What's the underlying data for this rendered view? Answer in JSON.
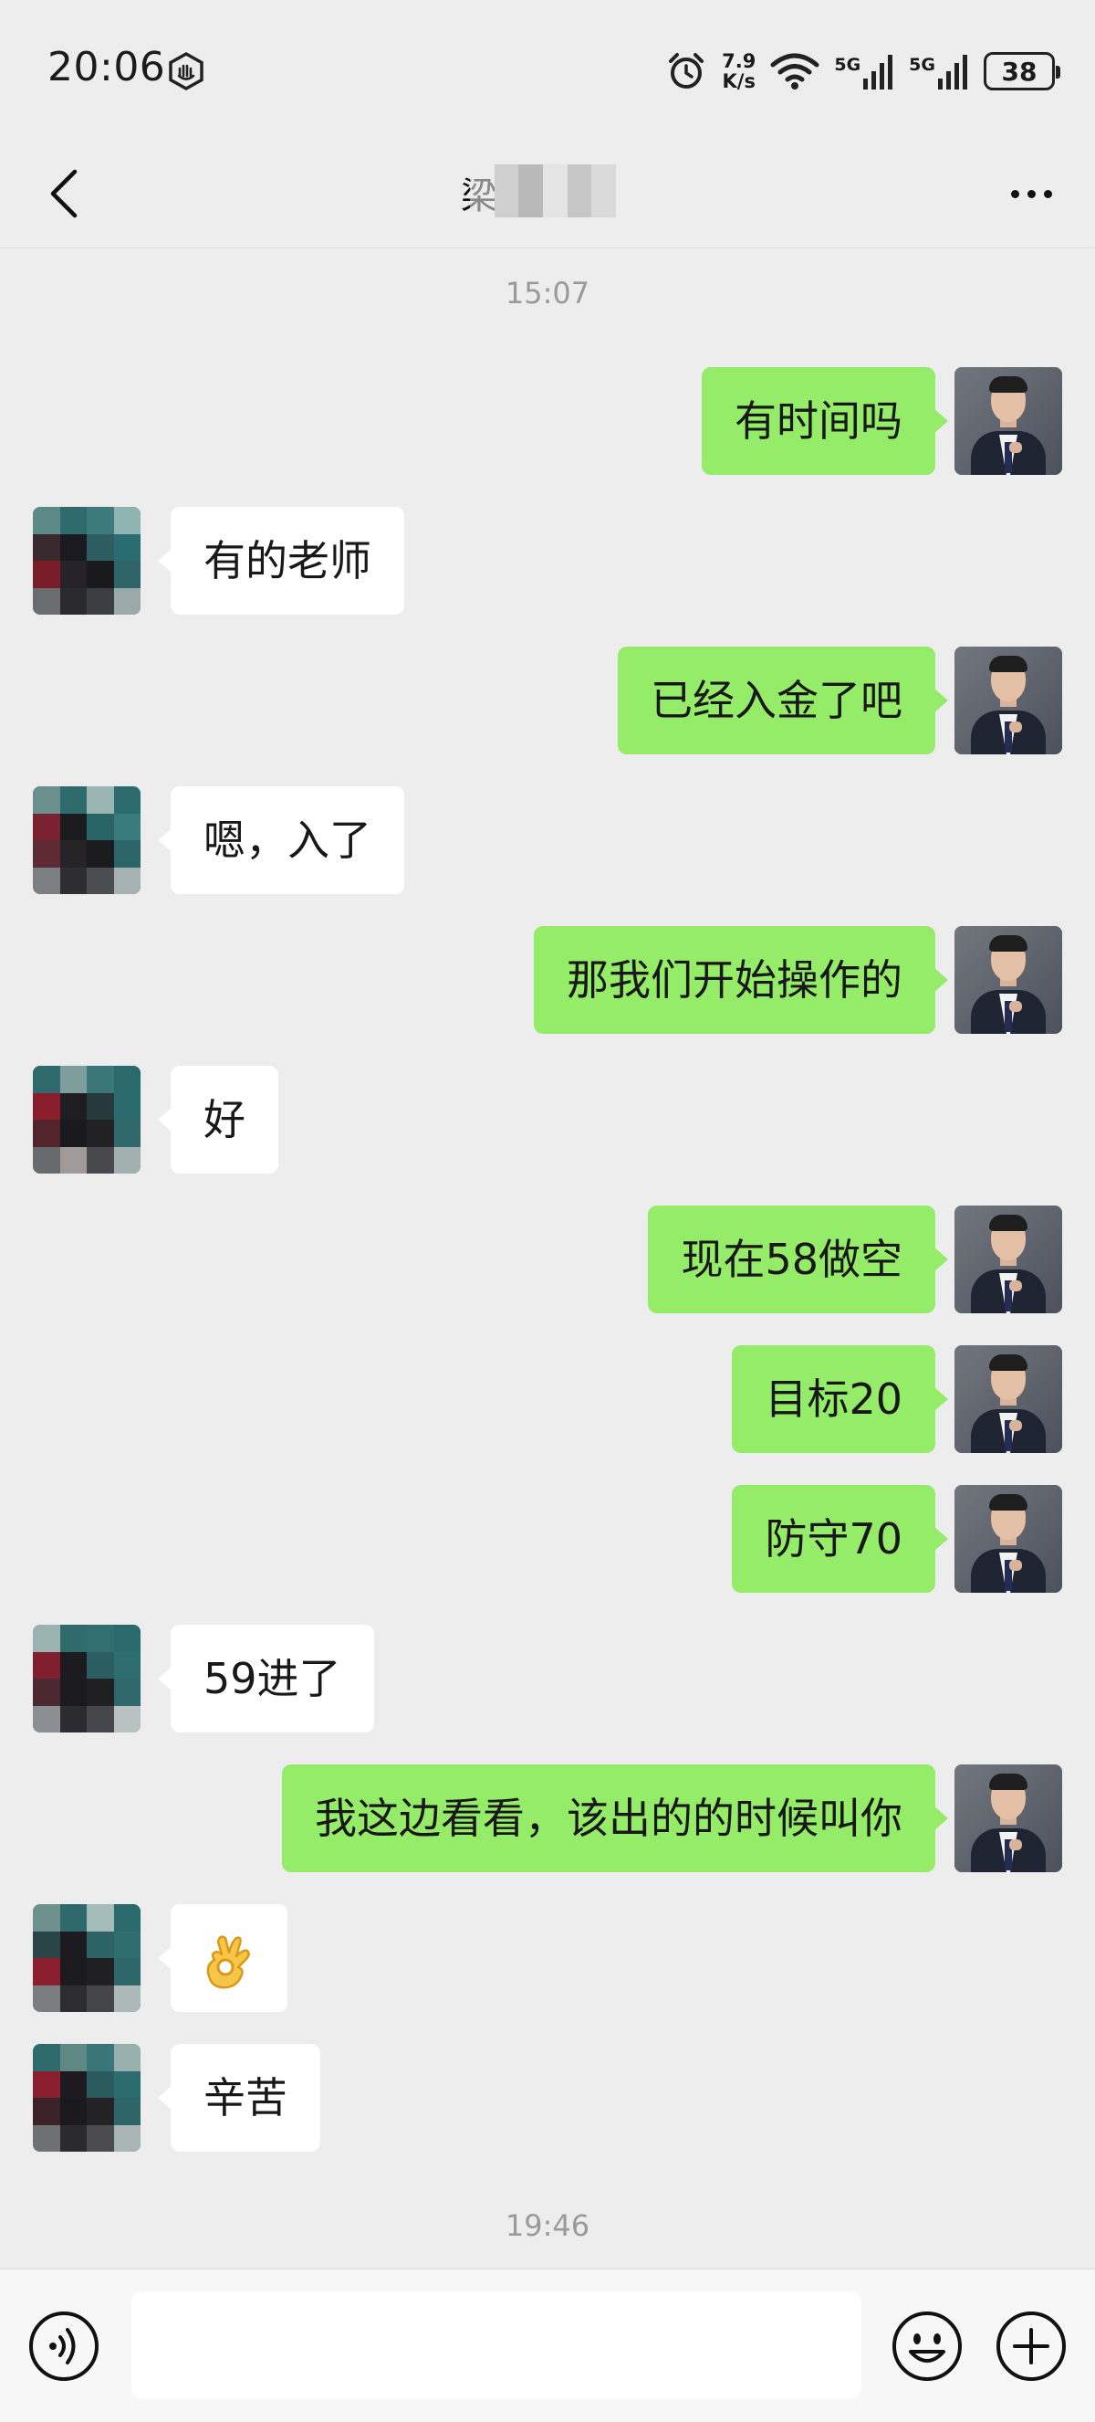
{
  "status_bar": {
    "time": "20:06",
    "net_speed_value": "7.9",
    "net_speed_unit": "K/s",
    "sim1_label": "5G",
    "sim2_label": "5G",
    "battery": "38"
  },
  "header": {
    "title": "梁",
    "back_icon": "chevron-left-icon",
    "more_icon": "more-dots-icon"
  },
  "timestamps": {
    "first": "15:07",
    "second": "19:46"
  },
  "messages": [
    {
      "side": "right",
      "text": "有时间吗"
    },
    {
      "side": "left",
      "text": "有的老师"
    },
    {
      "side": "right",
      "text": "已经入金了吧"
    },
    {
      "side": "left",
      "text": "嗯，入了"
    },
    {
      "side": "right",
      "text": "那我们开始操作的"
    },
    {
      "side": "left",
      "text": "好"
    },
    {
      "side": "right",
      "text": "现在58做空"
    },
    {
      "side": "right",
      "text": "目标20"
    },
    {
      "side": "right",
      "text": "防守70"
    },
    {
      "side": "left",
      "text": "59进了"
    },
    {
      "side": "right",
      "text": "我这边看看，该出的的时候叫你"
    },
    {
      "side": "left",
      "text": "",
      "emoji": "ok-hand-icon"
    },
    {
      "side": "left",
      "text": "辛苦"
    }
  ],
  "input_bar": {
    "value": "",
    "voice_icon": "voice-icon",
    "emoji_icon": "smiley-icon",
    "plus_icon": "plus-icon"
  },
  "colors": {
    "background": "#ededed",
    "sent_bubble": "#95ec69",
    "received_bubble": "#ffffff",
    "timestamp": "#9a9a9a"
  }
}
